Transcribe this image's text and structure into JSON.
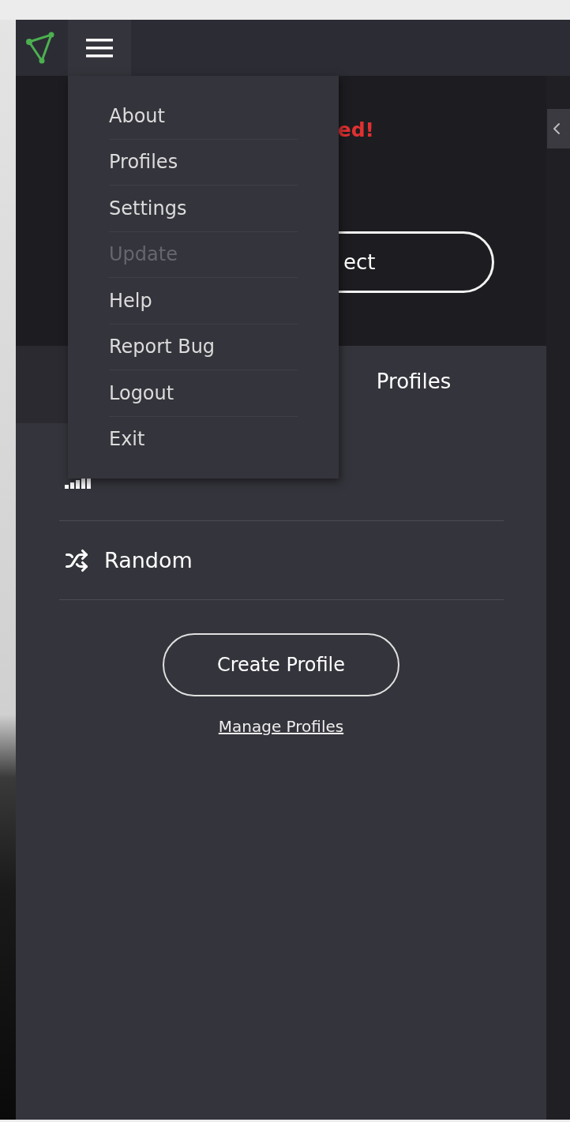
{
  "menu": {
    "open": true,
    "items": [
      {
        "label": "About",
        "disabled": false
      },
      {
        "label": "Profiles",
        "disabled": false
      },
      {
        "label": "Settings",
        "disabled": false
      },
      {
        "label": "Update",
        "disabled": true
      },
      {
        "label": "Help",
        "disabled": false
      },
      {
        "label": "Report Bug",
        "disabled": false
      },
      {
        "label": "Logout",
        "disabled": false
      },
      {
        "label": "Exit",
        "disabled": false
      }
    ]
  },
  "status": {
    "text": "ed!",
    "connected": false
  },
  "connect_button": {
    "label": "ect"
  },
  "tabs": [
    {
      "selected": false
    },
    {
      "label": "Profiles",
      "selected": true
    }
  ],
  "profiles": [
    {
      "kind": "fastest"
    },
    {
      "kind": "random",
      "label": "Random"
    }
  ],
  "create_button": {
    "label": "Create Profile"
  },
  "manage_link": {
    "label": "Manage Profiles"
  }
}
